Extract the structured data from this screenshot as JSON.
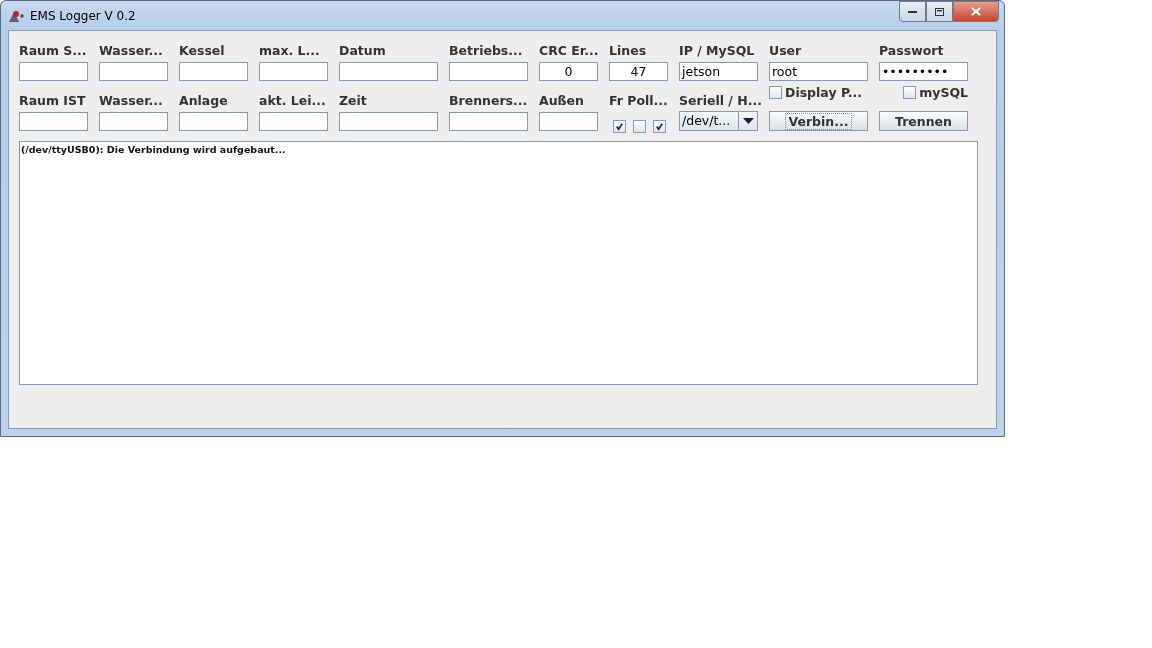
{
  "window": {
    "title": "EMS Logger V 0.2"
  },
  "row_1": [
    {
      "kind": "field",
      "label": "Raum S..."
    },
    {
      "kind": "field",
      "label": "Wasser..."
    },
    {
      "kind": "field",
      "label": "Kessel"
    },
    {
      "kind": "field",
      "label": "max. L..."
    },
    {
      "kind": "field",
      "label": "Datum"
    },
    {
      "kind": "field",
      "label": "Betriebs..."
    },
    {
      "kind": "number",
      "label": "CRC Er...",
      "value": "0"
    },
    {
      "kind": "number",
      "label": "Lines",
      "value": "47"
    },
    {
      "kind": "field",
      "label": "IP / MySQL",
      "value": "jetson"
    },
    {
      "kind": "field",
      "label": "User",
      "value": "root"
    },
    {
      "kind": "field",
      "label": "Passwort",
      "value": "•••••••••"
    }
  ],
  "row_2": [
    {
      "kind": "field",
      "label": "Raum IST"
    },
    {
      "kind": "field",
      "label": "Wasser..."
    },
    {
      "kind": "field",
      "label": "Anlage"
    },
    {
      "kind": "field",
      "label": "akt. Lei..."
    },
    {
      "kind": "field",
      "label": "Zeit"
    },
    {
      "kind": "field",
      "label": "Brenners..."
    },
    {
      "kind": "field",
      "label": "Außen"
    },
    {
      "kind": "checkboxes",
      "label": "Fr Poll...",
      "checks": [
        true,
        false,
        true
      ]
    },
    {
      "kind": "dropdown",
      "label": "Seriell / H...",
      "value": "/dev/t..."
    },
    {
      "kind": "button",
      "option": {
        "label": "Display P...",
        "checked": false
      },
      "button": "Verbin...",
      "focused": true
    },
    {
      "kind": "button",
      "option": {
        "label": "mySQL",
        "checked": false
      },
      "button": "Trennen",
      "focused": false
    }
  ],
  "log": [
    "(/dev/ttyUSB0): Die Verbindung wird aufgebaut..."
  ]
}
